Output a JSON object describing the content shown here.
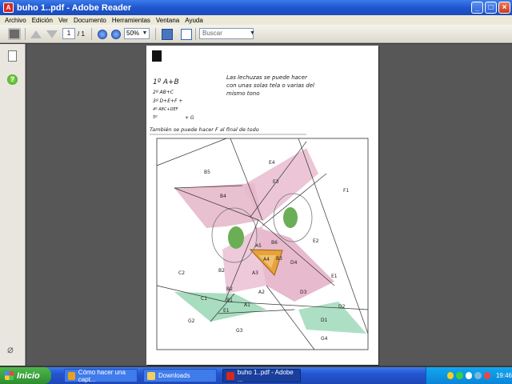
{
  "window": {
    "title": "buho 1..pdf - Adobe Reader",
    "icon_text": "A"
  },
  "menu": [
    "Archivo",
    "Edición",
    "Ver",
    "Documento",
    "Herramientas",
    "Ventana",
    "Ayuda"
  ],
  "toolbar": {
    "page_current": "1",
    "page_total": "/ 1",
    "zoom": "50%",
    "search_placeholder": "Buscar"
  },
  "document": {
    "notes": [
      "1º A+B",
      "2º AB+C",
      "3º D+E+F +",
      "4º ABC+DEF",
      "5º",
      "+ G"
    ],
    "side_note_lines": [
      "Las lechuzas se puede hacer",
      "con unas solas tela o varias del",
      "mismo tono"
    ],
    "instruction": "También se puede hacer F al final de todo",
    "labels": [
      "B5",
      "E4",
      "E3",
      "B4",
      "F1",
      "B6",
      "A5",
      "E2",
      "A4",
      "B3",
      "D4",
      "C2",
      "B2",
      "A3",
      "E1",
      "B2",
      "A2",
      "D3",
      "C1",
      "B1",
      "E1",
      "A1",
      "D2",
      "G2",
      "D1",
      "G3",
      "G4"
    ]
  },
  "taskbar": {
    "start_label": "Inicio",
    "tasks": [
      "Cómo hacer una capt...",
      "Downloads",
      "buho 1..pdf - Adobe ..."
    ],
    "clock": "19:46"
  }
}
